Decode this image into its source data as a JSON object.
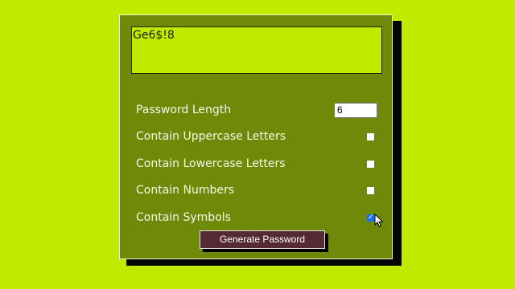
{
  "colors": {
    "page_background": "#bfeb00",
    "card_background": "#6f8a08",
    "output_background": "#bfeb00",
    "label_text": "#f4f8e6",
    "button_background": "#562a32",
    "checkbox_checked": "#1f6fe0"
  },
  "output": {
    "password": "Ge6$!8"
  },
  "length": {
    "label": "Password Length",
    "value": "6"
  },
  "options": [
    {
      "label": "Contain Uppercase Letters",
      "checked": false
    },
    {
      "label": "Contain Lowercase Letters",
      "checked": false
    },
    {
      "label": "Contain Numbers",
      "checked": false
    },
    {
      "label": "Contain Symbols",
      "checked": true
    }
  ],
  "button": {
    "label": "Generate Password"
  },
  "cursor_icon": "mouse-pointer-icon"
}
